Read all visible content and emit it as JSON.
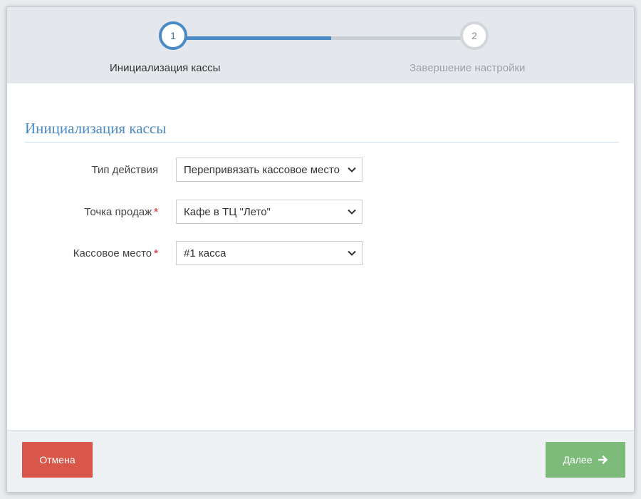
{
  "steps": [
    {
      "number": "1",
      "label": "Инициализация кассы",
      "state": "active"
    },
    {
      "number": "2",
      "label": "Завершение настройки",
      "state": "inactive"
    }
  ],
  "section": {
    "title": "Инициализация кассы"
  },
  "form": {
    "action_type": {
      "label": "Тип действия",
      "value": "Перепривязать кассовое место",
      "required": false
    },
    "sales_point": {
      "label": "Точка продаж",
      "value": "Кафе в ТЦ \"Лето\"",
      "required": true
    },
    "cash_place": {
      "label": "Кассовое место",
      "value": "#1 касса",
      "required": true
    },
    "required_mark": "*"
  },
  "footer": {
    "cancel_label": "Отмена",
    "next_label": "Далее"
  },
  "colors": {
    "accent": "#4a8bc6",
    "cancel": "#d9574a",
    "next": "#7cbb7a",
    "required": "#d9534f"
  },
  "icons": {
    "dropdown": "chevron-down-icon",
    "next": "arrow-right-icon"
  }
}
